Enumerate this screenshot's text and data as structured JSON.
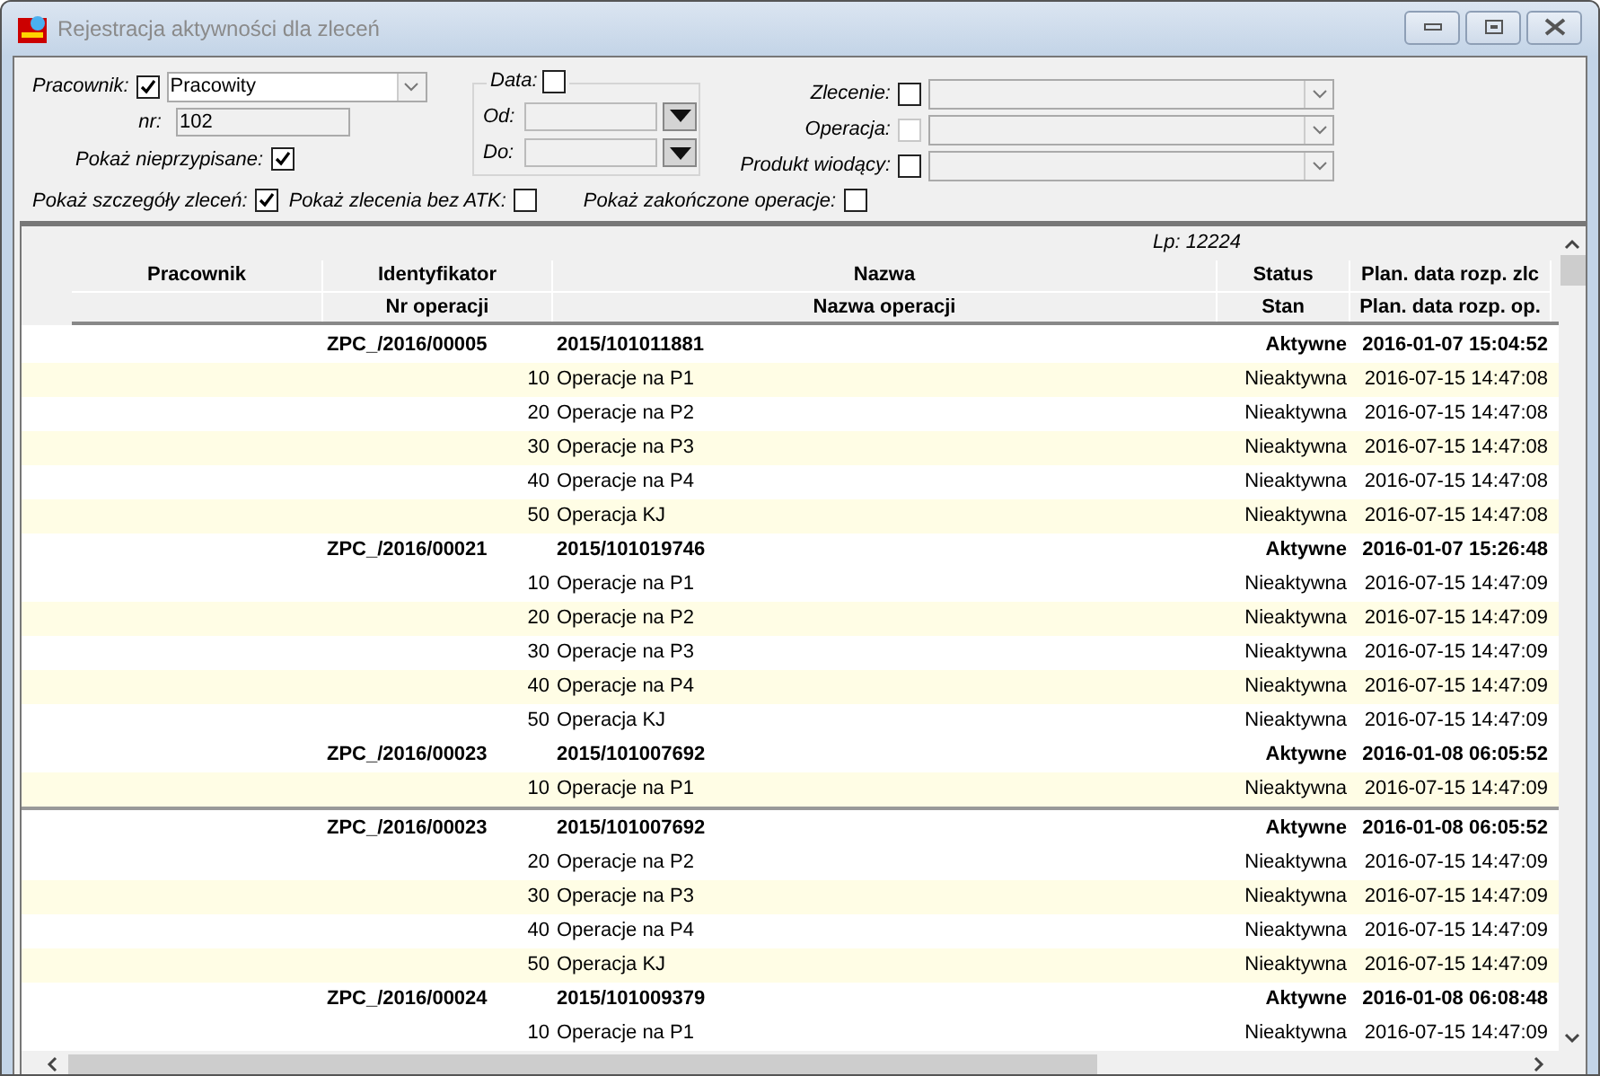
{
  "window": {
    "title": "Rejestracja aktywności dla zleceń"
  },
  "filters": {
    "employee": {
      "label": "Pracownik:",
      "checked": true,
      "value": "Pracowity"
    },
    "number": {
      "label": "nr:",
      "value": "102"
    },
    "unassigned": {
      "label": "Pokaż nieprzypisane:",
      "checked": true
    },
    "date": {
      "label": "Data:",
      "checked": false,
      "from_label": "Od:",
      "to_label": "Do:"
    },
    "selectors": [
      {
        "label": "Zlecenie:",
        "checked": false,
        "disabled": false
      },
      {
        "label": "Operacja:",
        "checked": false,
        "disabled": true
      },
      {
        "label": "Produkt wiodący:",
        "checked": false,
        "disabled": false
      }
    ],
    "options": [
      {
        "label": "Pokaż szczegóły zleceń:",
        "checked": true
      },
      {
        "label": "Pokaż zlecenia bez ATK:",
        "checked": false
      },
      {
        "label": "Pokaż zakończone operacje:",
        "checked": false
      }
    ]
  },
  "table": {
    "count": "Lp: 12224",
    "columns": [
      {
        "top": "Pracownik"
      },
      {
        "top": "Identyfikator",
        "bottom": "Nr operacji"
      },
      {
        "top": "Nazwa",
        "bottom": "Nazwa operacji"
      },
      {
        "top": "Status",
        "bottom": "Stan"
      },
      {
        "top": "Plan. data rozp. zlc",
        "bottom": "Plan. data rozp. op."
      }
    ],
    "panes": [
      {
        "rows": [
          {
            "kind": "order",
            "shaded": false,
            "id": "ZPC_/2016/00005",
            "name": "2015/101011881",
            "status": "Aktywne",
            "date": "2016-01-07 15:04:52"
          },
          {
            "kind": "operation",
            "shaded": true,
            "id": "10",
            "name": "Operacje na P1",
            "status": "Nieaktywna",
            "date": "2016-07-15 14:47:08"
          },
          {
            "kind": "operation",
            "shaded": false,
            "id": "20",
            "name": "Operacje na P2",
            "status": "Nieaktywna",
            "date": "2016-07-15 14:47:08"
          },
          {
            "kind": "operation",
            "shaded": true,
            "id": "30",
            "name": "Operacje na P3",
            "status": "Nieaktywna",
            "date": "2016-07-15 14:47:08"
          },
          {
            "kind": "operation",
            "shaded": false,
            "id": "40",
            "name": "Operacje na P4",
            "status": "Nieaktywna",
            "date": "2016-07-15 14:47:08"
          },
          {
            "kind": "operation",
            "shaded": true,
            "id": "50",
            "name": "Operacja KJ",
            "status": "Nieaktywna",
            "date": "2016-07-15 14:47:08"
          },
          {
            "kind": "order",
            "shaded": false,
            "id": "ZPC_/2016/00021",
            "name": "2015/101019746",
            "status": "Aktywne",
            "date": "2016-01-07 15:26:48"
          },
          {
            "kind": "operation",
            "shaded": false,
            "id": "10",
            "name": "Operacje na P1",
            "status": "Nieaktywna",
            "date": "2016-07-15 14:47:09"
          },
          {
            "kind": "operation",
            "shaded": true,
            "id": "20",
            "name": "Operacje na P2",
            "status": "Nieaktywna",
            "date": "2016-07-15 14:47:09"
          },
          {
            "kind": "operation",
            "shaded": false,
            "id": "30",
            "name": "Operacje na P3",
            "status": "Nieaktywna",
            "date": "2016-07-15 14:47:09"
          },
          {
            "kind": "operation",
            "shaded": true,
            "id": "40",
            "name": "Operacje na P4",
            "status": "Nieaktywna",
            "date": "2016-07-15 14:47:09"
          },
          {
            "kind": "operation",
            "shaded": false,
            "id": "50",
            "name": "Operacja KJ",
            "status": "Nieaktywna",
            "date": "2016-07-15 14:47:09"
          },
          {
            "kind": "order",
            "shaded": false,
            "id": "ZPC_/2016/00023",
            "name": "2015/101007692",
            "status": "Aktywne",
            "date": "2016-01-08 06:05:52"
          },
          {
            "kind": "operation",
            "shaded": true,
            "id": "10",
            "name": "Operacje na P1",
            "status": "Nieaktywna",
            "date": "2016-07-15 14:47:09"
          }
        ]
      },
      {
        "rows": [
          {
            "kind": "order",
            "shaded": false,
            "id": "ZPC_/2016/00023",
            "name": "2015/101007692",
            "status": "Aktywne",
            "date": "2016-01-08 06:05:52"
          },
          {
            "kind": "operation",
            "shaded": false,
            "id": "20",
            "name": "Operacje na P2",
            "status": "Nieaktywna",
            "date": "2016-07-15 14:47:09"
          },
          {
            "kind": "operation",
            "shaded": true,
            "id": "30",
            "name": "Operacje na P3",
            "status": "Nieaktywna",
            "date": "2016-07-15 14:47:09"
          },
          {
            "kind": "operation",
            "shaded": false,
            "id": "40",
            "name": "Operacje na P4",
            "status": "Nieaktywna",
            "date": "2016-07-15 14:47:09"
          },
          {
            "kind": "operation",
            "shaded": true,
            "id": "50",
            "name": "Operacja KJ",
            "status": "Nieaktywna",
            "date": "2016-07-15 14:47:09"
          },
          {
            "kind": "order",
            "shaded": false,
            "id": "ZPC_/2016/00024",
            "name": "2015/101009379",
            "status": "Aktywne",
            "date": "2016-01-08 06:08:48"
          },
          {
            "kind": "operation",
            "shaded": false,
            "id": "10",
            "name": "Operacje na P1",
            "status": "Nieaktywna",
            "date": "2016-07-15 14:47:09"
          }
        ]
      }
    ]
  }
}
